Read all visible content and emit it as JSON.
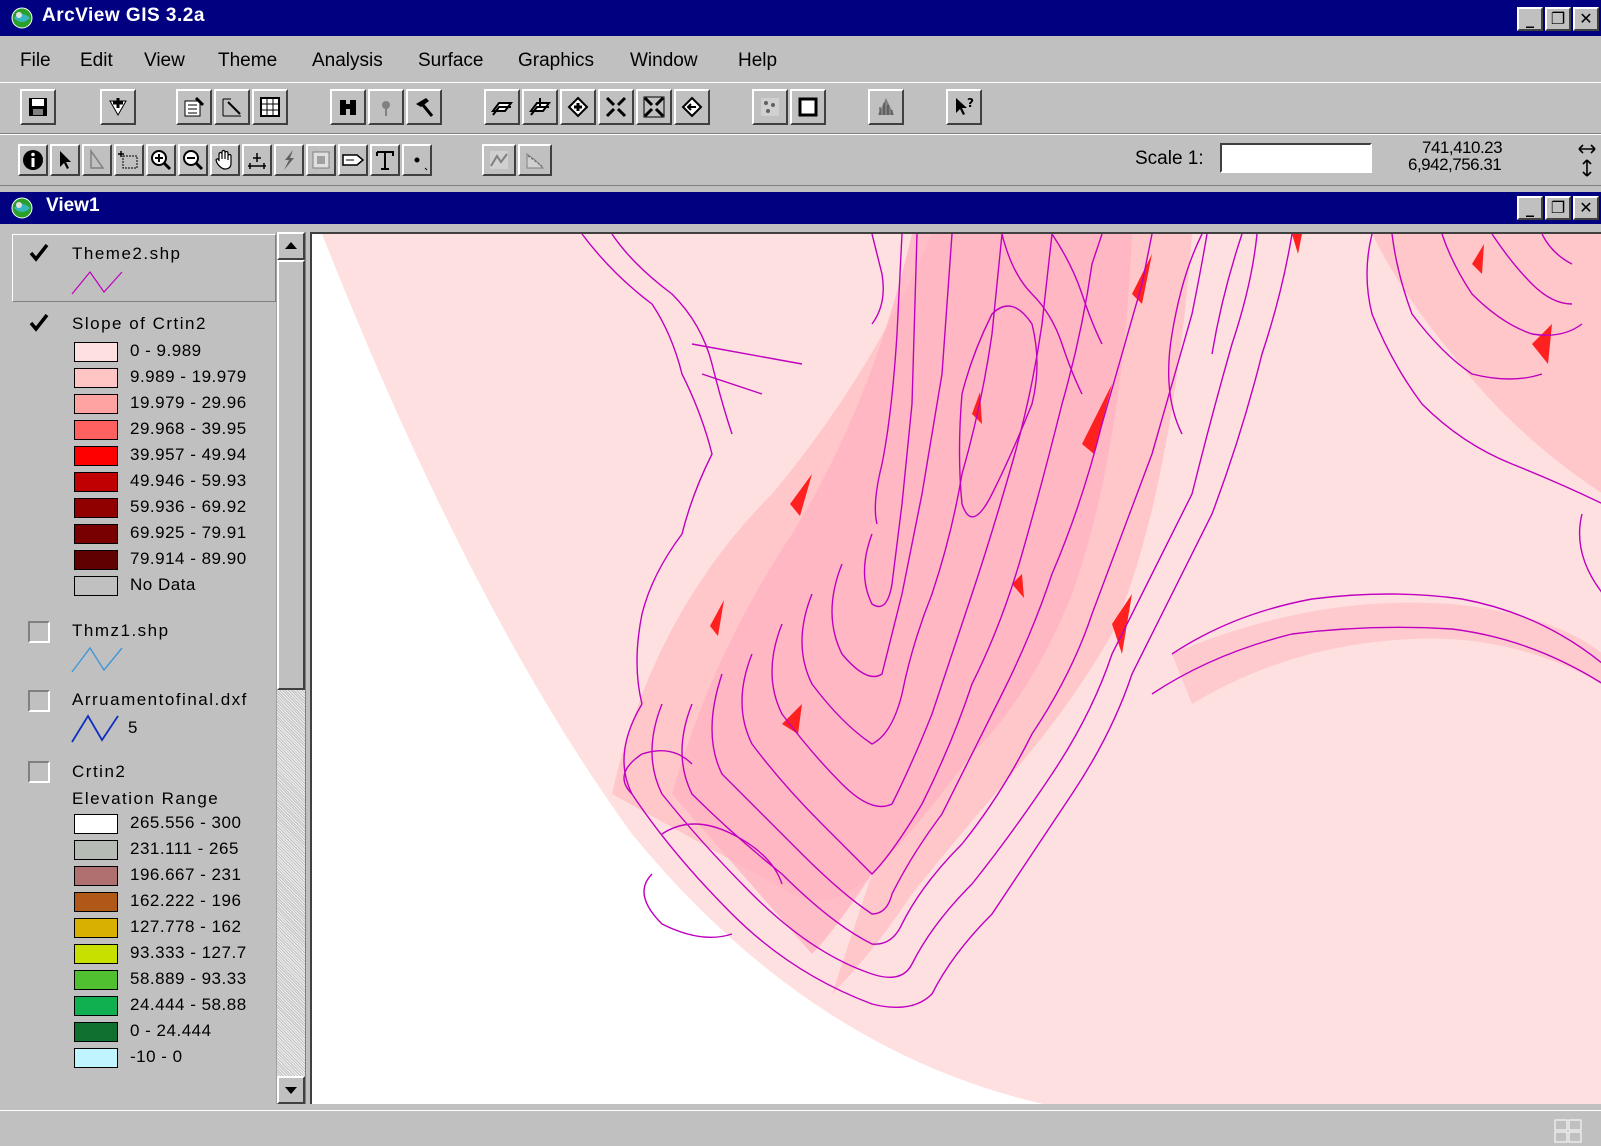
{
  "app": {
    "title": "ArcView GIS 3.2a"
  },
  "menu": [
    {
      "label": "File"
    },
    {
      "label": "Edit"
    },
    {
      "label": "View"
    },
    {
      "label": "Theme"
    },
    {
      "label": "Analysis"
    },
    {
      "label": "Surface"
    },
    {
      "label": "Graphics"
    },
    {
      "label": "Window"
    },
    {
      "label": "Help"
    }
  ],
  "toolbar": {
    "scale_label": "Scale 1:",
    "scale_value": "",
    "coord_x": "741,410.23",
    "coord_y": "6,942,756.31"
  },
  "view": {
    "title": "View1"
  },
  "legend": {
    "themes": [
      {
        "name": "Theme2.shp",
        "visible": true
      },
      {
        "name": "Slope of Crtin2",
        "visible": true,
        "classes": [
          {
            "label": "0 - 9.989",
            "color": "#ffe0e0"
          },
          {
            "label": "9.989 - 19.979",
            "color": "#ffc4c4"
          },
          {
            "label": "19.979 - 29.96",
            "color": "#ffa2a2"
          },
          {
            "label": "29.968 - 39.95",
            "color": "#ff6060"
          },
          {
            "label": "39.957 - 49.94",
            "color": "#ff0000"
          },
          {
            "label": "49.946 - 59.93",
            "color": "#c00000"
          },
          {
            "label": "59.936 - 69.92",
            "color": "#900000"
          },
          {
            "label": "69.925 - 79.91",
            "color": "#780000"
          },
          {
            "label": "79.914 - 89.90",
            "color": "#600000"
          },
          {
            "label": "No Data",
            "color": "#c0c0c0"
          }
        ]
      },
      {
        "name": "Thmz1.shp",
        "visible": false
      },
      {
        "name": "Arruamentofinal.dxf",
        "visible": false,
        "sublabel": "5"
      },
      {
        "name": "Crtin2",
        "visible": false,
        "field": "Elevation Range",
        "classes": [
          {
            "label": "265.556 - 300",
            "color": "#ffffff"
          },
          {
            "label": "231.111 - 265",
            "color": "#b4bcb4"
          },
          {
            "label": "196.667 - 231",
            "color": "#b07070"
          },
          {
            "label": "162.222 - 196",
            "color": "#b05818"
          },
          {
            "label": "127.778 - 162",
            "color": "#d8b000"
          },
          {
            "label": "93.333 - 127.7",
            "color": "#c8e000"
          },
          {
            "label": "58.889 - 93.33",
            "color": "#50c030"
          },
          {
            "label": "24.444 - 58.88",
            "color": "#10b050"
          },
          {
            "label": "0 - 24.444",
            "color": "#107030"
          },
          {
            "label": "-10 - 0",
            "color": "#c0f4ff"
          }
        ]
      }
    ]
  },
  "colors": {
    "titlebar": "#000080",
    "contour": "#c000c0",
    "slope_base": "#ffe0e0",
    "slope_mid": "#ffb4c0",
    "slope_high": "#ff0000"
  }
}
